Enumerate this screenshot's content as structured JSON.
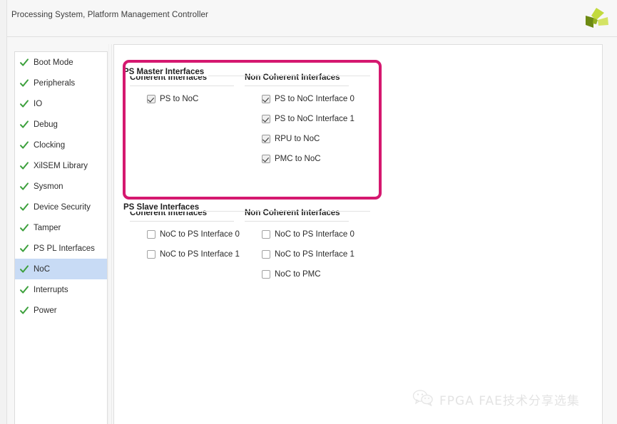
{
  "window": {
    "title": "Processing System, Platform Management Controller",
    "logo_icon": "amd-xilinx-pinwheel-logo",
    "logo_colors": [
      "#b9d13a",
      "#c8dd4c",
      "#6f8a16",
      "#8fae21"
    ]
  },
  "sidebar": {
    "items": [
      {
        "label": "Boot Mode",
        "icon": "green-check-icon",
        "selected": false
      },
      {
        "label": "Peripherals",
        "icon": "green-check-icon",
        "selected": false
      },
      {
        "label": "IO",
        "icon": "green-check-icon",
        "selected": false
      },
      {
        "label": "Debug",
        "icon": "green-check-icon",
        "selected": false
      },
      {
        "label": "Clocking",
        "icon": "green-check-icon",
        "selected": false
      },
      {
        "label": "XilSEM Library",
        "icon": "green-check-icon",
        "selected": false
      },
      {
        "label": "Sysmon",
        "icon": "green-check-icon",
        "selected": false
      },
      {
        "label": "Device Security",
        "icon": "green-check-icon",
        "selected": false
      },
      {
        "label": "Tamper",
        "icon": "green-check-icon",
        "selected": false
      },
      {
        "label": "PS PL Interfaces",
        "icon": "green-check-icon",
        "selected": false
      },
      {
        "label": "NoC",
        "icon": "green-check-icon",
        "selected": true
      },
      {
        "label": "Interrupts",
        "icon": "green-check-icon",
        "selected": false
      },
      {
        "label": "Power",
        "icon": "green-check-icon",
        "selected": false
      }
    ],
    "check_color": "#3ca03c",
    "selected_color": "#c8dbf5"
  },
  "main": {
    "groups": [
      {
        "title": "PS Master Interfaces",
        "columns": [
          {
            "title": "Coherent Interfaces",
            "options": [
              {
                "label": "PS to NoC",
                "checked": true
              }
            ]
          },
          {
            "title": "Non Coherent Interfaces",
            "options": [
              {
                "label": "PS to NoC Interface 0",
                "checked": true
              },
              {
                "label": "PS to NoC Interface 1",
                "checked": true
              },
              {
                "label": "RPU to NoC",
                "checked": true
              },
              {
                "label": "PMC to NoC",
                "checked": true
              }
            ]
          }
        ]
      },
      {
        "title": "PS Slave Interfaces",
        "columns": [
          {
            "title": "Coherent Interfaces",
            "options": [
              {
                "label": "NoC to PS Interface 0",
                "checked": false
              },
              {
                "label": "NoC to PS Interface 1",
                "checked": false
              }
            ]
          },
          {
            "title": "Non Coherent Interfaces",
            "options": [
              {
                "label": "NoC to PS Interface 0",
                "checked": false
              },
              {
                "label": "NoC to PS Interface 1",
                "checked": false
              },
              {
                "label": "NoC to PMC",
                "checked": false
              }
            ]
          }
        ]
      }
    ]
  },
  "annotation": {
    "highlight_color": "#d5186f",
    "highlight_target": "PS Master Interfaces"
  },
  "watermark": {
    "text": "FPGA FAE技术分享选集",
    "icon": "wechat-icon",
    "color": "#c9c9c9"
  }
}
